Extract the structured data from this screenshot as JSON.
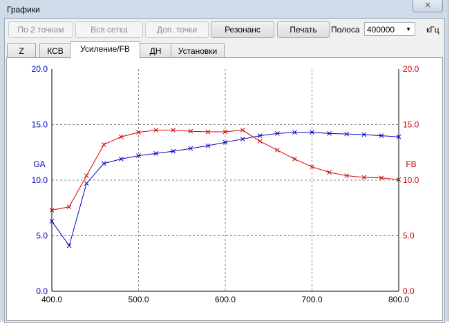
{
  "window": {
    "title": "Графики",
    "close_icon": "close-icon"
  },
  "toolbar": {
    "by2": "По 2 точкам",
    "grid": "Вся сетка",
    "extra": "Доп. точки",
    "resonance": "Резонанс",
    "print": "Печать",
    "band_label": "Полоса",
    "band_value": "400000",
    "unit": "кГц"
  },
  "tabs": [
    "Z",
    "КСВ",
    "Усиление/FB",
    "ДН",
    "Установки"
  ],
  "chart_data": {
    "type": "line",
    "x": [
      400,
      420,
      440,
      460,
      480,
      500,
      520,
      540,
      560,
      580,
      600,
      620,
      640,
      660,
      680,
      700,
      720,
      740,
      760,
      780,
      800
    ],
    "xlim": [
      400,
      800
    ],
    "ylim": [
      0,
      20
    ],
    "xticks": [
      "400.0",
      "500.0",
      "600.0",
      "700.0",
      "800.0"
    ],
    "yticks": [
      "0.0",
      "5.0",
      "10.0",
      "15.0",
      "20.0"
    ],
    "ylabel_left": "GA",
    "ylabel_right": "FB",
    "grid": true,
    "series": [
      {
        "name": "GA",
        "color": "#0000c0",
        "values": [
          6.3,
          4.1,
          9.7,
          11.5,
          11.9,
          12.2,
          12.4,
          12.6,
          12.85,
          13.1,
          13.4,
          13.7,
          14.0,
          14.2,
          14.3,
          14.3,
          14.2,
          14.15,
          14.1,
          14.0,
          13.9
        ]
      },
      {
        "name": "FB",
        "color": "#d00000",
        "values": [
          7.3,
          7.6,
          10.4,
          13.2,
          13.9,
          14.3,
          14.5,
          14.5,
          14.4,
          14.35,
          14.35,
          14.5,
          13.5,
          12.7,
          11.9,
          11.2,
          10.7,
          10.4,
          10.25,
          10.2,
          10.05
        ]
      }
    ]
  }
}
